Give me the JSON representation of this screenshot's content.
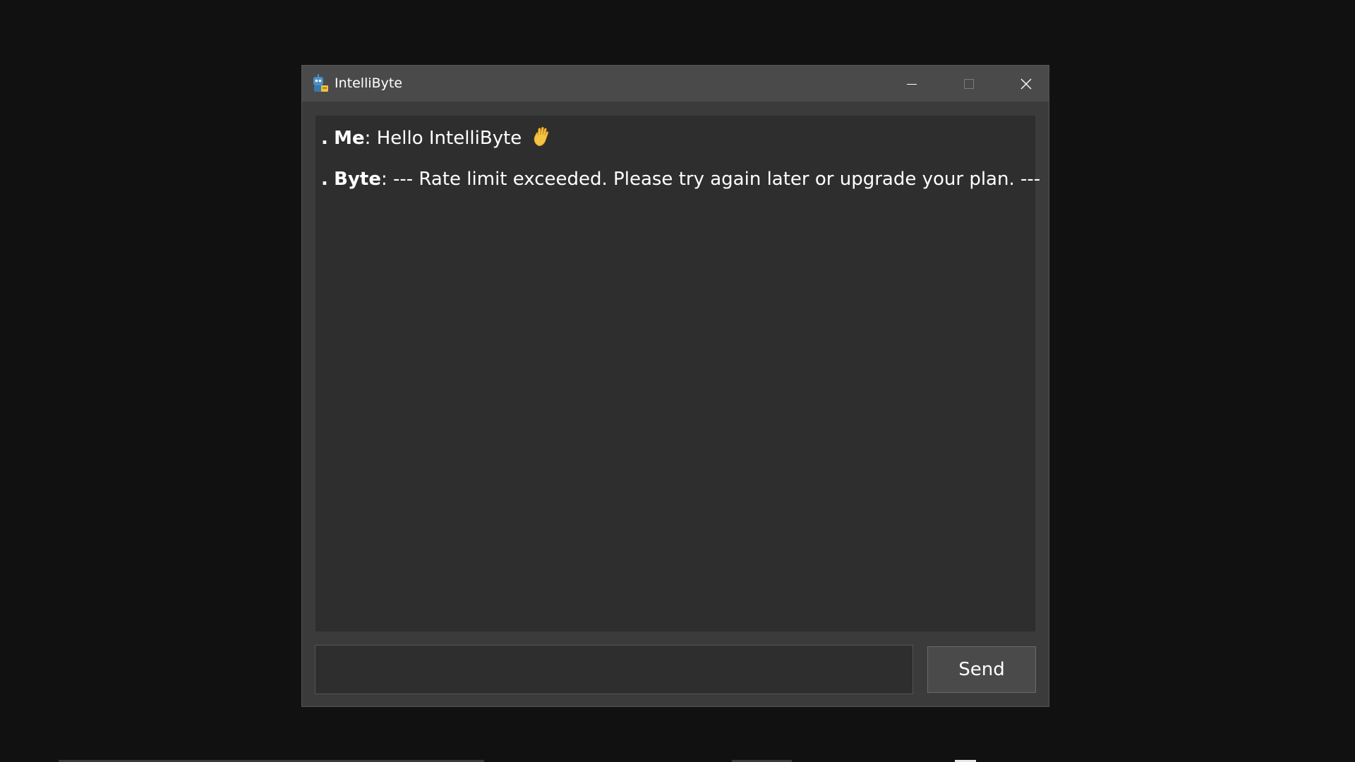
{
  "window": {
    "title": "IntelliByte",
    "icon": "robot-app-icon"
  },
  "titlebar_buttons": {
    "minimize_icon": "minimize-icon",
    "maximize_icon": "maximize-icon",
    "close_icon": "close-icon"
  },
  "chat": {
    "messages": [
      {
        "bullet": ".",
        "sender": "Me",
        "separator": ":",
        "text": "Hello IntelliByte",
        "icon": "waving-hand-icon"
      },
      {
        "bullet": ".",
        "sender": "Byte",
        "separator": ":",
        "text": "--- Rate limit exceeded. Please try again later or upgrade your plan. ---"
      }
    ]
  },
  "input": {
    "value": "",
    "placeholder": ""
  },
  "send_button": {
    "label": "Send"
  },
  "colors": {
    "desktop_bg": "#111111",
    "window_bg": "#3b3b3b",
    "titlebar_bg": "#4a4a4a",
    "chat_bg": "#2e2e2e",
    "text": "#ffffff"
  }
}
